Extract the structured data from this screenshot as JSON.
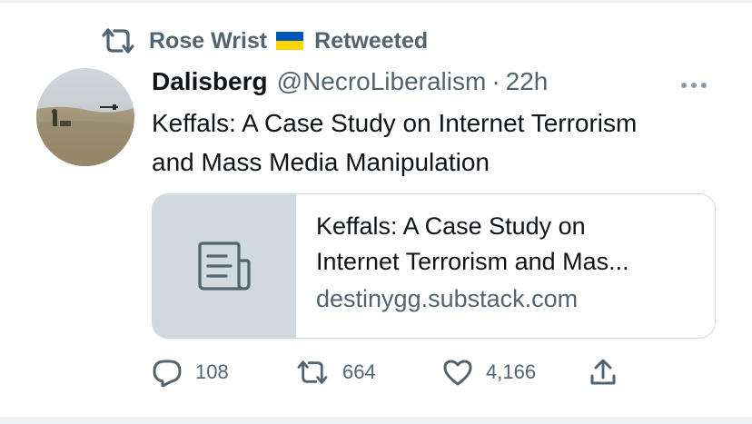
{
  "retweet": {
    "user": "Rose Wrist",
    "label": "Retweeted"
  },
  "tweet": {
    "display_name": "Dalisberg",
    "handle": "@NecroLiberalism",
    "separator": "·",
    "time": "22h",
    "text_line1": "Keffals: A Case Study on Internet Terrorism",
    "text_line2": "and Mass Media Manipulation"
  },
  "card": {
    "title_line1": "Keffals: A Case Study on",
    "title_line2": "Internet Terrorism and Mas...",
    "domain": "destinygg.substack.com"
  },
  "actions": {
    "replies": "108",
    "retweets": "664",
    "likes": "4,166"
  },
  "colors": {
    "secondary_text": "#536471",
    "border": "#cfd9de",
    "flag_blue": "#0057b7",
    "flag_yellow": "#ffd700"
  }
}
